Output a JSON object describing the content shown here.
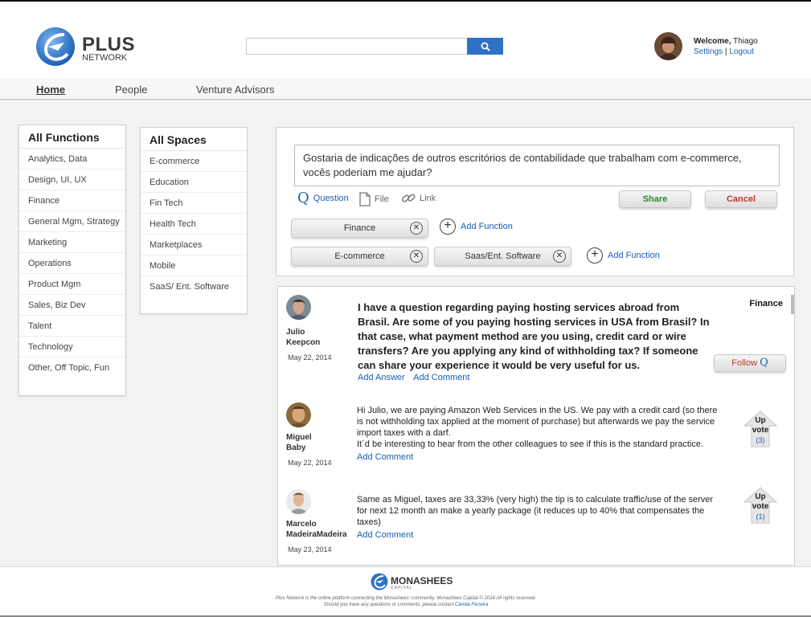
{
  "brand": {
    "title": "PLUS",
    "subtitle": "NETWORK"
  },
  "search": {
    "placeholder": ""
  },
  "user": {
    "welcome_prefix": "Welcome,",
    "name": "Thiago",
    "settings": "Settings",
    "separator": "|",
    "logout": "Logout"
  },
  "nav": {
    "home": "Home",
    "people": "People",
    "venture": "Venture Advisors"
  },
  "functions": {
    "title": "All Functions",
    "items": [
      "Analytics, Data",
      "Design, UI, UX",
      "Finance",
      "General Mgm, Strategy",
      "Marketing",
      "Operations",
      "Product Mgm",
      "Sales, Biz Dev",
      "Talent",
      "Technology",
      "Other, Off Topic, Fun"
    ]
  },
  "spaces": {
    "title": "All Spaces",
    "items": [
      "E-commerce",
      "Education",
      "Fin Tech",
      "Health Tech",
      "Marketplaces",
      "Mobile",
      "SaaS/ Ent. Software"
    ]
  },
  "compose": {
    "text": "Gostaria de indicações de outros escritórios de contabilidade que trabalham com e-commerce, vocês poderiam me ajudar?",
    "question": "Question",
    "file": "File",
    "link": "Link",
    "share": "Share",
    "cancel": "Cancel",
    "tags_row1": [
      "Finance"
    ],
    "tags_row2": [
      "E-commerce",
      "Saas/Ent. Software"
    ],
    "add_function": "Add Function"
  },
  "feed": {
    "question": {
      "author_first": "Julio",
      "author_last": "Keepcon",
      "date": "May 22, 2014",
      "tag": "Finance",
      "text": "I have a question regarding paying hosting services abroad from Brasil. Are some of you paying hosting services in USA from Brasil? In that case, what payment method are you using, credit card or wire transfers? Are you applying any kind of withholding tax? If someone can share your experience it would be very useful for us.",
      "add_answer": "Add Answer",
      "add_comment": "Add Comment",
      "follow": "Follow"
    },
    "answers": [
      {
        "author_first": "Miguel",
        "author_last": "Baby",
        "date": "May 22, 2014",
        "text": "Hi Julio, we are paying Amazon Web Services in the US. We pay with a credit card (so there is not withholding tax applied at the moment of purchase) but afterwards we pay the service import taxes with a darf.",
        "text2": "It´d be interesting to hear from the other colleagues to see if this is the standard practice.",
        "add_comment": "Add Comment",
        "upvote_label_1": "Up",
        "upvote_label_2": "vote",
        "votes": "(3)"
      },
      {
        "author_first": "Marcelo",
        "author_last": "MadeiraMadeira",
        "date": "May 23, 2014",
        "text": "Same as Miguel, taxes are 33,33% (very high) the tip is to calculate traffic/use of the server for next 12 month an make a yearly package (it reduces up to 40% that compensates the taxes)",
        "add_comment": "Add Comment",
        "upvote_label_1": "Up",
        "upvote_label_2": "vote",
        "votes": "(1)"
      }
    ]
  },
  "footer": {
    "brand": "MONASHEES",
    "brand_sub": "CAPITAL",
    "line1": "Plus Network is the online platform connecting the Monashees' community. Monashees Capital © 2014 All rights reserved.",
    "line2": "Should you have any questions or comments, please contact",
    "contact": "Camila Ferreira"
  },
  "colors": {
    "accent": "#2f72c5",
    "link": "#1a5fb4",
    "share": "#2c8a2c",
    "cancel": "#c0392b"
  }
}
